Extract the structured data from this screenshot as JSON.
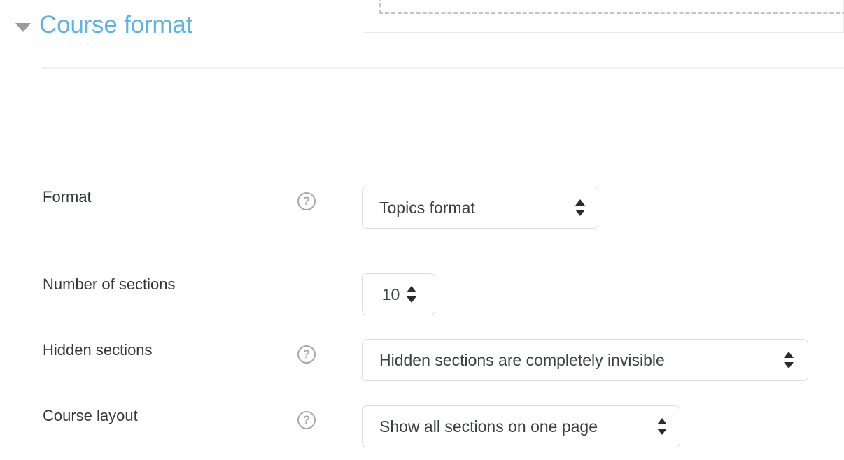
{
  "section": {
    "title": "Course format",
    "caret_icon": "triangle-down-icon",
    "collapsed": false
  },
  "upload": {
    "dropzone_icon": "dashed-drop-zone"
  },
  "help_icon_glyph": "?",
  "fields": [
    {
      "id": "format",
      "label": "Format",
      "has_help": true,
      "control": "select",
      "value": "Topics format"
    },
    {
      "id": "number-of-sections",
      "label": "Number of sections",
      "has_help": false,
      "control": "select",
      "value": "10"
    },
    {
      "id": "hidden-sections",
      "label": "Hidden sections",
      "has_help": true,
      "control": "select",
      "value": "Hidden sections are completely invisible"
    },
    {
      "id": "course-layout",
      "label": "Course layout",
      "has_help": true,
      "control": "select",
      "value": "Show all sections on one page"
    }
  ],
  "colors": {
    "accent": "#5eb3e4",
    "label_text": "#34383c",
    "value_text": "#3b4046",
    "border": "#dcdee0",
    "divider": "#f0f1f2",
    "help_gray": "#a8a9ab",
    "caret_gray": "#9b9b9b",
    "dashed_gray": "#c3c5c7"
  }
}
